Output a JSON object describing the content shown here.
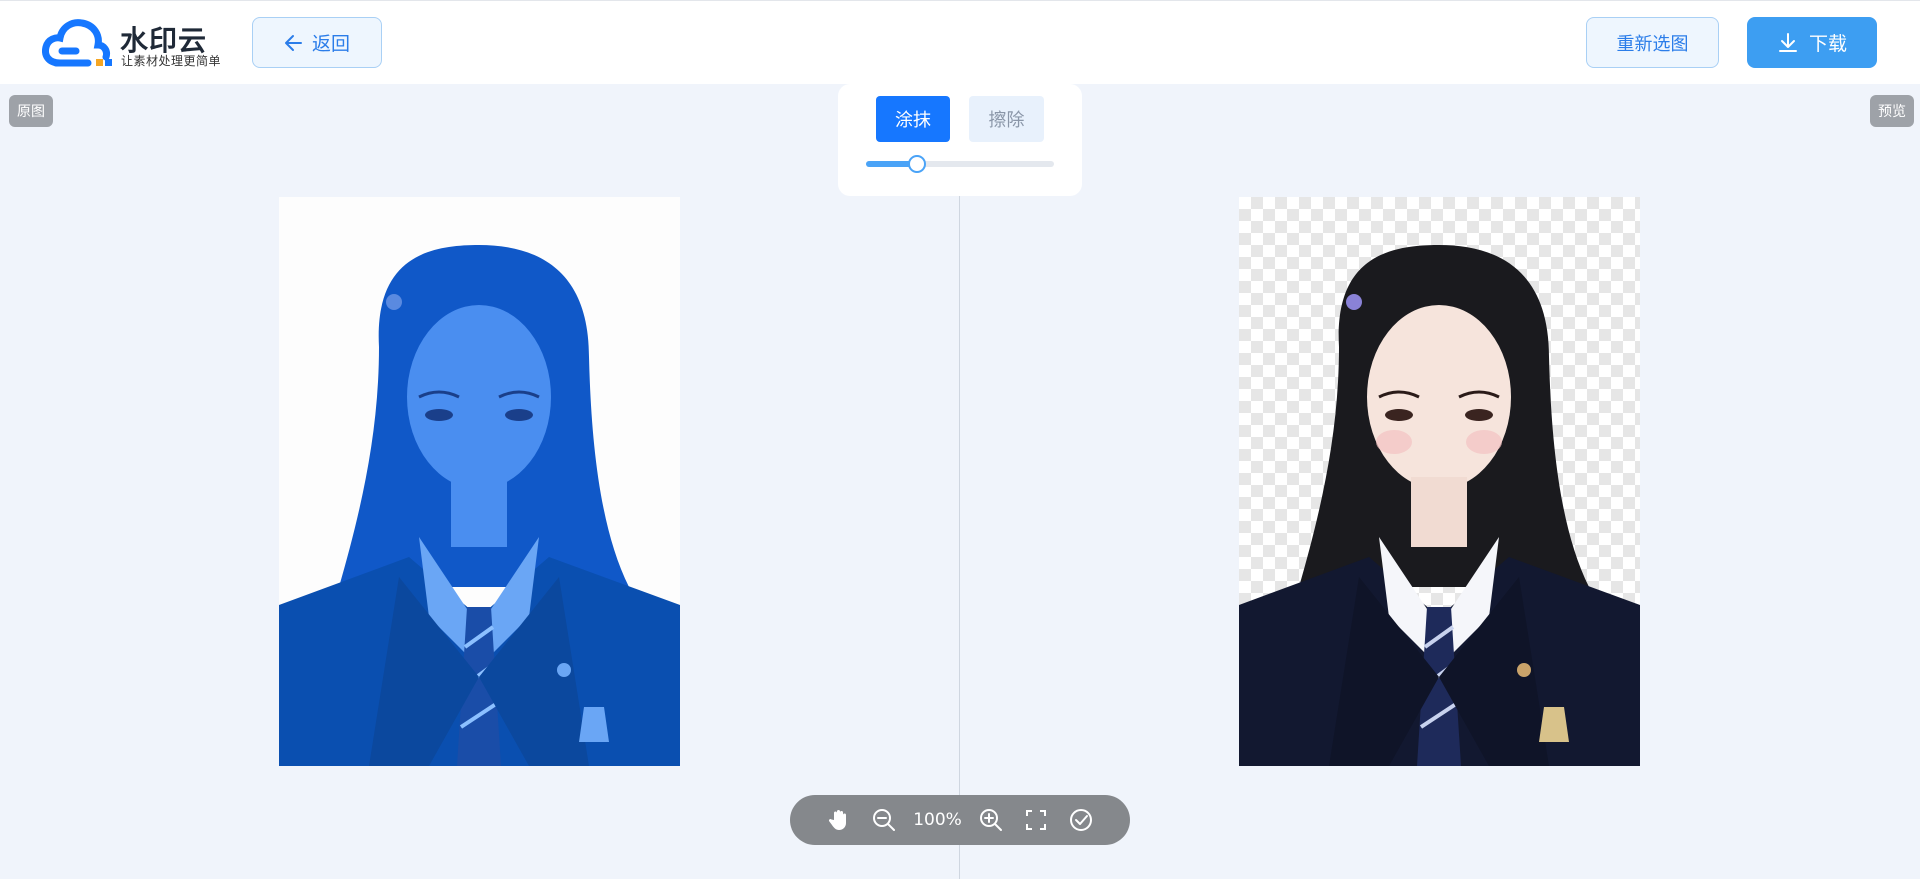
{
  "header": {
    "logo_title": "水印云",
    "logo_subtitle": "让素材处理更简单",
    "back_label": "返回",
    "reselect_label": "重新选图",
    "download_label": "下载"
  },
  "panels": {
    "original_label": "原图",
    "preview_label": "预览"
  },
  "brush": {
    "paint_label": "涂抹",
    "erase_label": "擦除",
    "active_mode": "paint",
    "size_fraction": 0.27
  },
  "toolbar": {
    "zoom_label": "100%",
    "icons": [
      "hand-icon",
      "zoom-out-icon",
      "zoom-in-icon",
      "fit-screen-icon",
      "confirm-icon"
    ]
  },
  "colors": {
    "primary": "#1677ff",
    "download": "#3d9ef2",
    "mask": "#1a64d6"
  }
}
